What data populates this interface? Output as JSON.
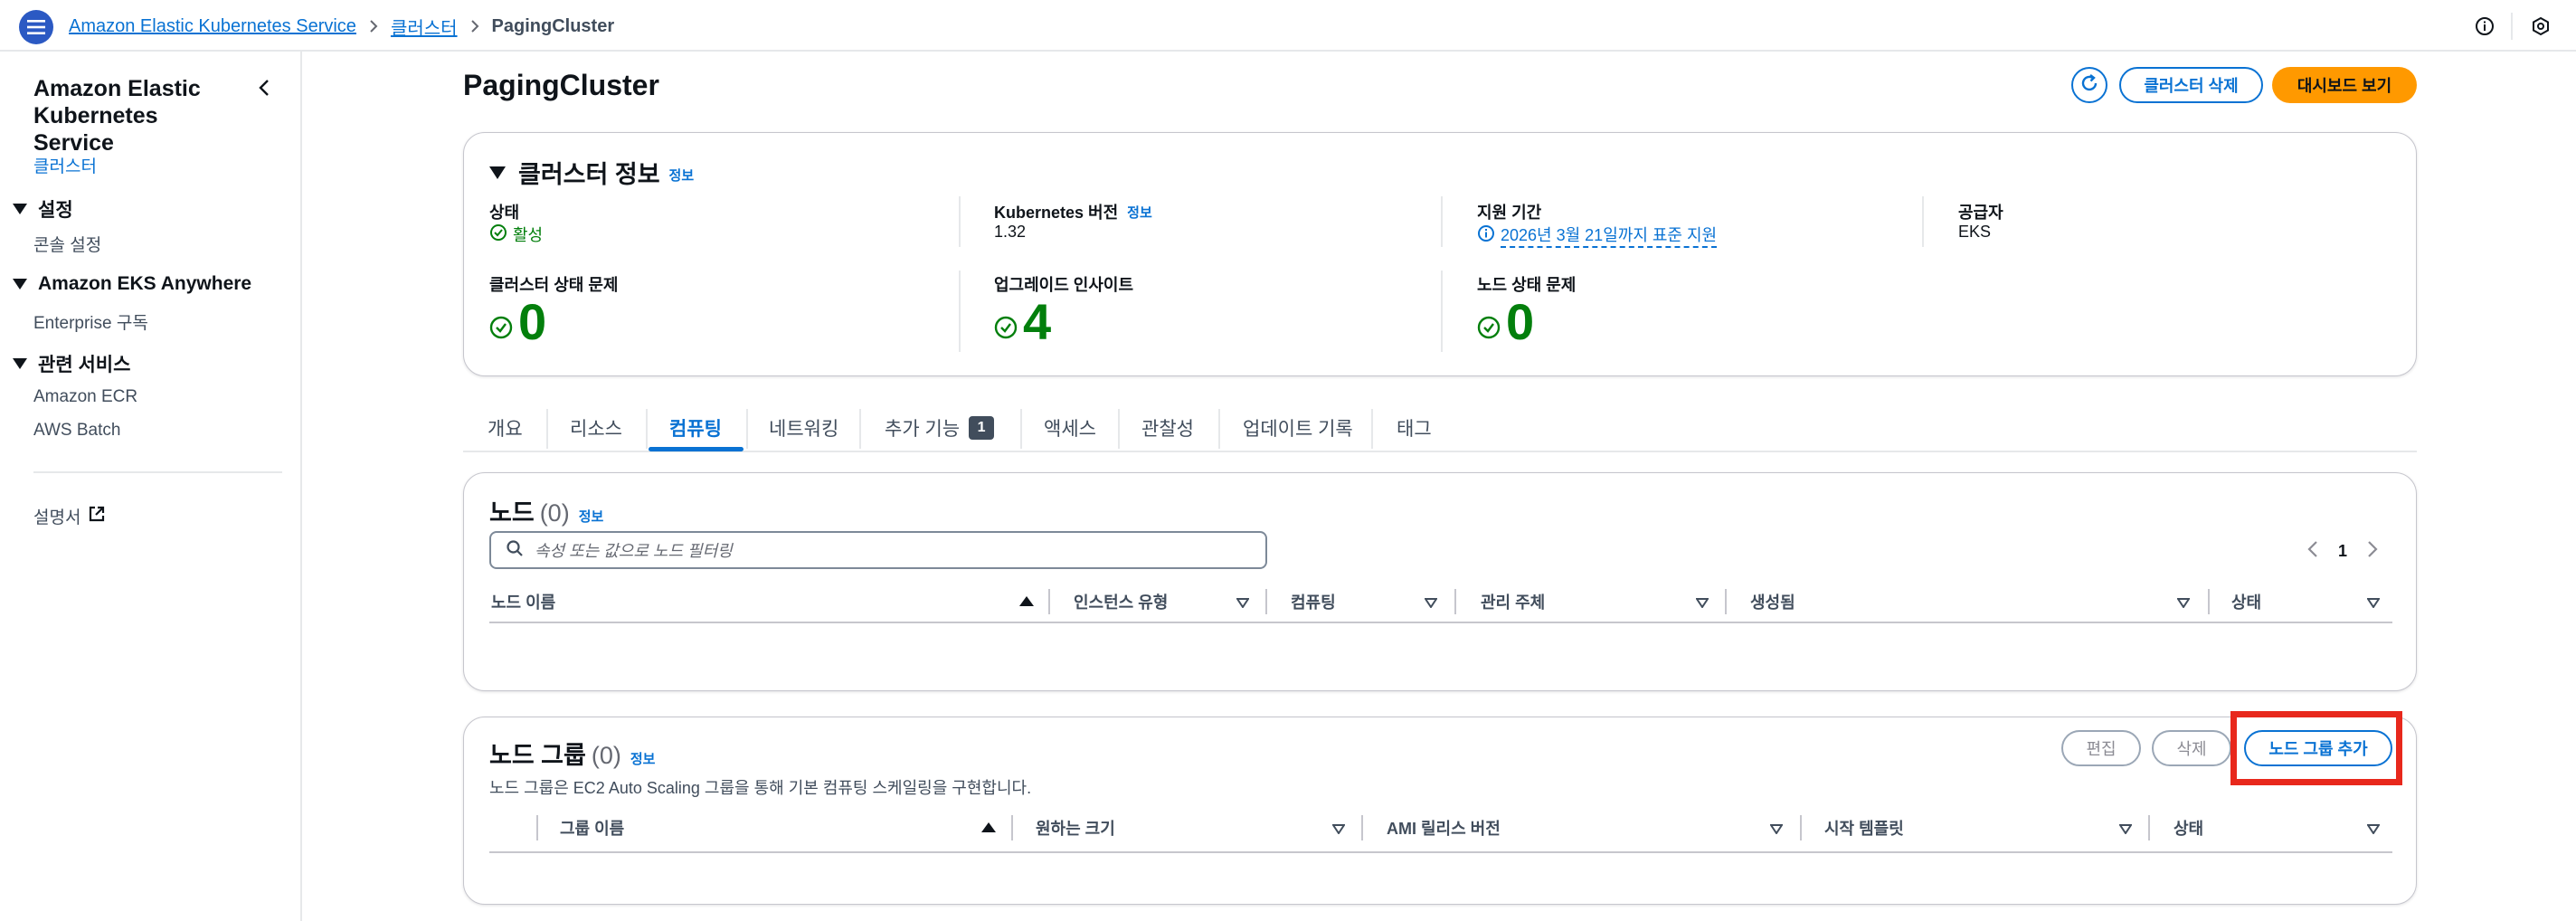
{
  "topbar": {
    "breadcrumbs": [
      "Amazon Elastic Kubernetes Service",
      "클러스터",
      "PagingCluster"
    ]
  },
  "sidenav": {
    "title": "Amazon Elastic Kubernetes Service",
    "active_link": "클러스터",
    "sections": [
      {
        "label": "설정",
        "items": [
          "콘솔 설정"
        ]
      },
      {
        "label": "Amazon EKS Anywhere",
        "items": [
          "Enterprise 구독"
        ]
      },
      {
        "label": "관련 서비스",
        "items": [
          "Amazon ECR",
          "AWS Batch"
        ]
      }
    ],
    "docs_link": "설명서"
  },
  "header": {
    "title": "PagingCluster",
    "delete_label": "클러스터 삭제",
    "dashboard_label": "대시보드 보기"
  },
  "cluster_info": {
    "title": "클러스터 정보",
    "info": "정보",
    "status_label": "상태",
    "status_value": "활성",
    "k8s_label": "Kubernetes 버전",
    "k8s_info": "정보",
    "k8s_value": "1.32",
    "support_label": "지원 기간",
    "support_value": "2026년 3월 21일까지 표준 지원",
    "provider_label": "공급자",
    "provider_value": "EKS",
    "health_label": "클러스터 상태 문제",
    "health_value": "0",
    "upgrade_label": "업그레이드 인사이트",
    "upgrade_value": "4",
    "node_health_label": "노드 상태 문제",
    "node_health_value": "0"
  },
  "tabs": [
    {
      "label": "개요"
    },
    {
      "label": "리소스"
    },
    {
      "label": "컴퓨팅",
      "active": true
    },
    {
      "label": "네트워킹"
    },
    {
      "label": "추가 기능",
      "badge": "1"
    },
    {
      "label": "액세스"
    },
    {
      "label": "관찰성"
    },
    {
      "label": "업데이트 기록"
    },
    {
      "label": "태그"
    }
  ],
  "nodes": {
    "title": "노드",
    "count": "(0)",
    "info": "정보",
    "search_placeholder": "속성 또는 값으로 노드 필터링",
    "page": "1",
    "columns": [
      "노드 이름",
      "인스턴스 유형",
      "컴퓨팅",
      "관리 주체",
      "생성됨",
      "상태"
    ]
  },
  "node_groups": {
    "title": "노드 그룹",
    "count": "(0)",
    "info": "정보",
    "description": "노드 그룹은 EC2 Auto Scaling 그룹을 통해 기본 컴퓨팅 스케일링을 구현합니다.",
    "edit_label": "편집",
    "delete_label": "삭제",
    "add_label": "노드 그룹 추가",
    "columns": [
      "그룹 이름",
      "원하는 크기",
      "AMI 릴리스 버전",
      "시작 템플릿",
      "상태"
    ]
  },
  "colors": {
    "accent": "#0972d3",
    "primary_button": "#ff9900",
    "success": "#037f0c",
    "highlight": "#e8281c"
  }
}
